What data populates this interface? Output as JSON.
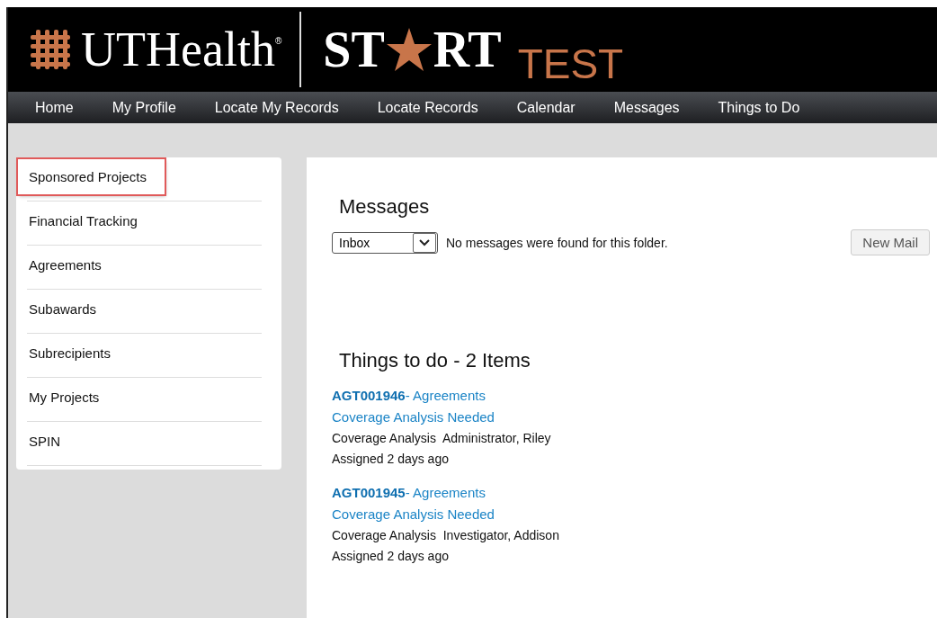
{
  "header": {
    "org": "UTHealth",
    "org_mark": "®",
    "product_start": "ST",
    "product_end": "RT",
    "env": "TEST"
  },
  "nav": [
    "Home",
    "My Profile",
    "Locate My Records",
    "Locate Records",
    "Calendar",
    "Messages",
    "Things to Do"
  ],
  "sidebar": {
    "items": [
      {
        "label": "Sponsored Projects",
        "highlighted": true
      },
      {
        "label": "Financial Tracking",
        "highlighted": false
      },
      {
        "label": "Agreements",
        "highlighted": false
      },
      {
        "label": "Subawards",
        "highlighted": false
      },
      {
        "label": "Subrecipients",
        "highlighted": false
      },
      {
        "label": "My Projects",
        "highlighted": false
      },
      {
        "label": "SPIN",
        "highlighted": false
      }
    ]
  },
  "messages": {
    "title": "Messages",
    "folder": "Inbox",
    "status": "No messages were found for this folder.",
    "new_button": "New Mail"
  },
  "todo": {
    "title": "Things to do - 2 Items",
    "items": [
      {
        "record": "**AGT001946**- Agreements",
        "task": "Coverage Analysis Needed",
        "detail": "Coverage Analysis  Administrator, Riley",
        "assigned": "Assigned 2 days ago"
      },
      {
        "record": "**AGT001945**- Agreements",
        "task": "Coverage Analysis Needed",
        "detail": "Coverage Analysis  Investigator, Addison",
        "assigned": "Assigned 2 days ago"
      }
    ]
  }
}
